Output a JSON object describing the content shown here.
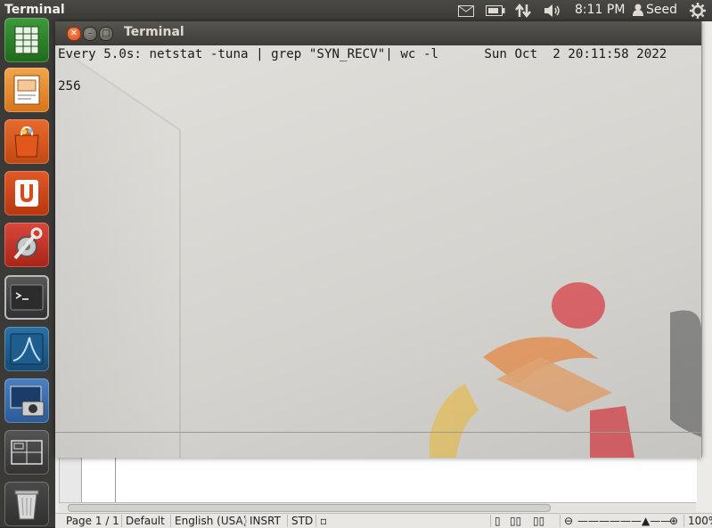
{
  "top_panel": {
    "app_title": "Terminal",
    "clock": "8:11 PM",
    "user": "Seed",
    "indicators": [
      "mail-icon",
      "battery-icon",
      "network-icon",
      "volume-icon",
      "gear-icon"
    ]
  },
  "launcher": {
    "items": [
      {
        "name": "libreoffice-calc"
      },
      {
        "name": "libreoffice-impress"
      },
      {
        "name": "ubuntu-software-center"
      },
      {
        "name": "ubuntu-one"
      },
      {
        "name": "system-settings"
      },
      {
        "name": "terminal"
      },
      {
        "name": "wireshark"
      },
      {
        "name": "screenshot"
      },
      {
        "name": "workspace-switcher"
      },
      {
        "name": "trash"
      }
    ]
  },
  "terminal": {
    "title": "Terminal",
    "header_line": "Every 5.0s: netstat -tuna | grep \"SYN_RECV\"| wc -l      Sun Oct  2 20:11:58 2022",
    "output": "256"
  },
  "office_status": {
    "page": "Page 1 / 1",
    "style": "Default",
    "language": "English (USA)",
    "insert_mode": "INSRT",
    "selection_mode": "STD",
    "zoom": "100%"
  },
  "colors": {
    "panel": "#3c3b37",
    "launcher": "#3b3a37",
    "close_button": "#df4a15",
    "terminal_text": "#1a1a1a"
  }
}
